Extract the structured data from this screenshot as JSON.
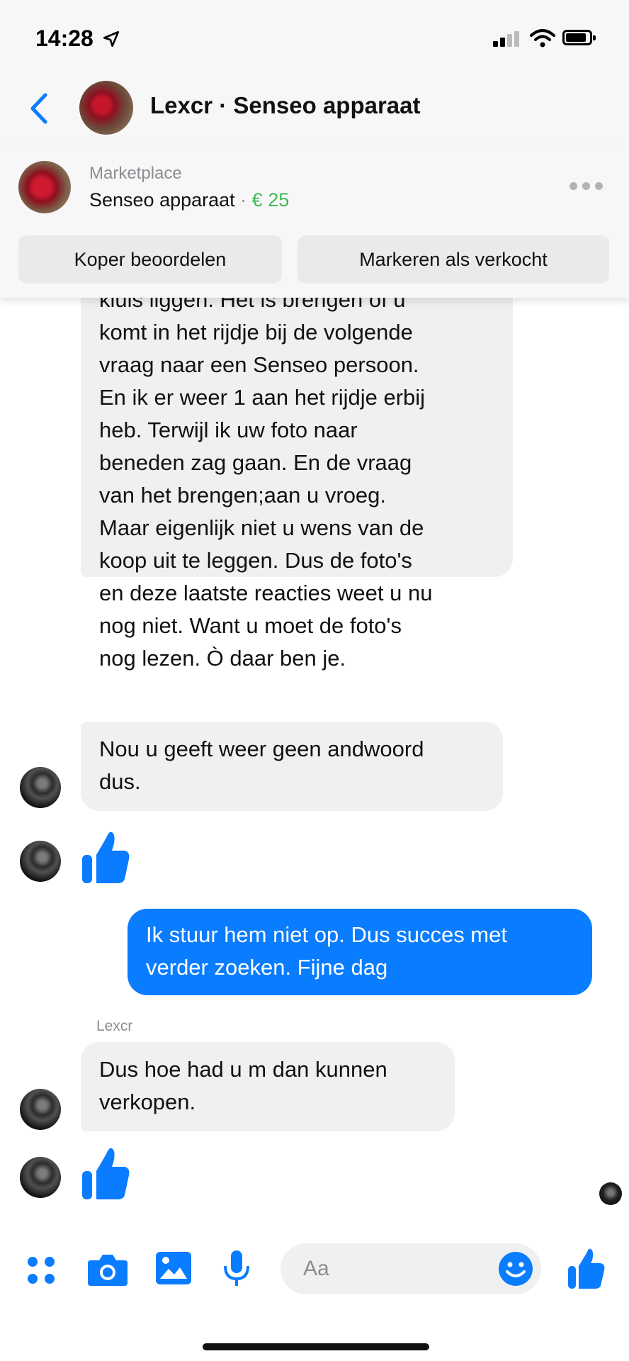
{
  "status_bar": {
    "time": "14:28",
    "location_arrow": "location-arrow-icon"
  },
  "header": {
    "title": "Lexcr · Senseo apparaat"
  },
  "marketplace": {
    "label": "Marketplace",
    "product": "Senseo apparaat",
    "separator": " · ",
    "price": "€ 25",
    "rate_buyer": "Koper beoordelen",
    "mark_sold": "Markeren als verkocht"
  },
  "messages": {
    "long_in": [
      "kluis liggen. Het is brengen of u",
      "komt in het rijdje bij de volgende",
      "vraag naar een Senseo persoon.",
      "En ik er weer 1 aan het rijdje erbij",
      "heb. Terwijl ik uw foto naar",
      "beneden zag gaan. En de vraag",
      "van het brengen;aan u vroeg.",
      "Maar eigenlijk niet u wens van de",
      "koop uit te leggen. Dus de foto's",
      "en deze laatste reacties weet u nu",
      "nog niet. Want u moet de foto's",
      "nog lezen. Ò daar ben je."
    ],
    "nou": [
      "Nou u geeft weer geen andwoord",
      "dus."
    ],
    "outgoing": [
      "Ik stuur hem niet op. Dus succes met",
      "verder zoeken. Fijne dag"
    ],
    "sender": "Lexcr",
    "dus_hoe": [
      "Dus hoe had u m dan kunnen",
      "verkopen."
    ]
  },
  "composer": {
    "placeholder": "Aa"
  },
  "colors": {
    "accent": "#0a7cff",
    "price_green": "#44b757",
    "bubble_in": "#f0f0f0"
  }
}
